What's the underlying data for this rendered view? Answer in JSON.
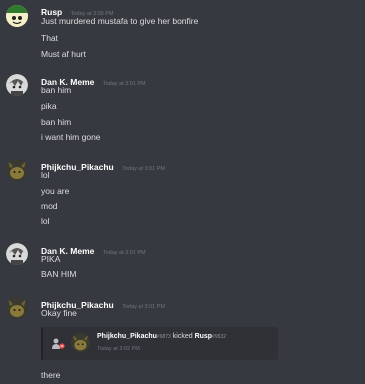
{
  "messages": [
    {
      "author": "Rusp",
      "time": "Today at 3:00 PM",
      "avatar": "rusp-avatar",
      "lines": [
        "Just murdered mustafa to give her bonfire",
        "That",
        "Must af hurt"
      ]
    },
    {
      "author": "Dan K. Meme",
      "time": "Today at 3:01 PM",
      "avatar": "dan-avatar",
      "lines": [
        "ban him",
        "pika",
        "ban him",
        "i want him gone"
      ]
    },
    {
      "author": "Phijkchu_Pikachu",
      "time": "Today at 3:01 PM",
      "avatar": "pikachu-avatar",
      "lines": [
        "lol",
        "you are",
        "mod",
        "lol"
      ]
    },
    {
      "author": "Dan K. Meme",
      "time": "Today at 3:01 PM",
      "avatar": "dan-avatar",
      "lines": [
        "PIKA",
        "BAN HIM"
      ]
    },
    {
      "author": "Phijkchu_Pikachu",
      "time": "Today at 3:01 PM",
      "avatar": "pikachu-avatar",
      "lines": [
        "Okay fine"
      ]
    }
  ],
  "embed": {
    "actor": "Phijkchu_Pikachu",
    "actor_discriminator": "#6873",
    "action": "kicked",
    "target": "Rusp",
    "target_discriminator": "#9532",
    "time": "Today at 3:02 PM",
    "icon": "kick-user-icon"
  },
  "trailing_line": "there",
  "colors": {
    "background": "#36393f",
    "text": "#dcddde",
    "author": "#ffffff",
    "timestamp": "#72767d",
    "embed_background": "#2f3136",
    "kick_icon": "#f04747"
  }
}
